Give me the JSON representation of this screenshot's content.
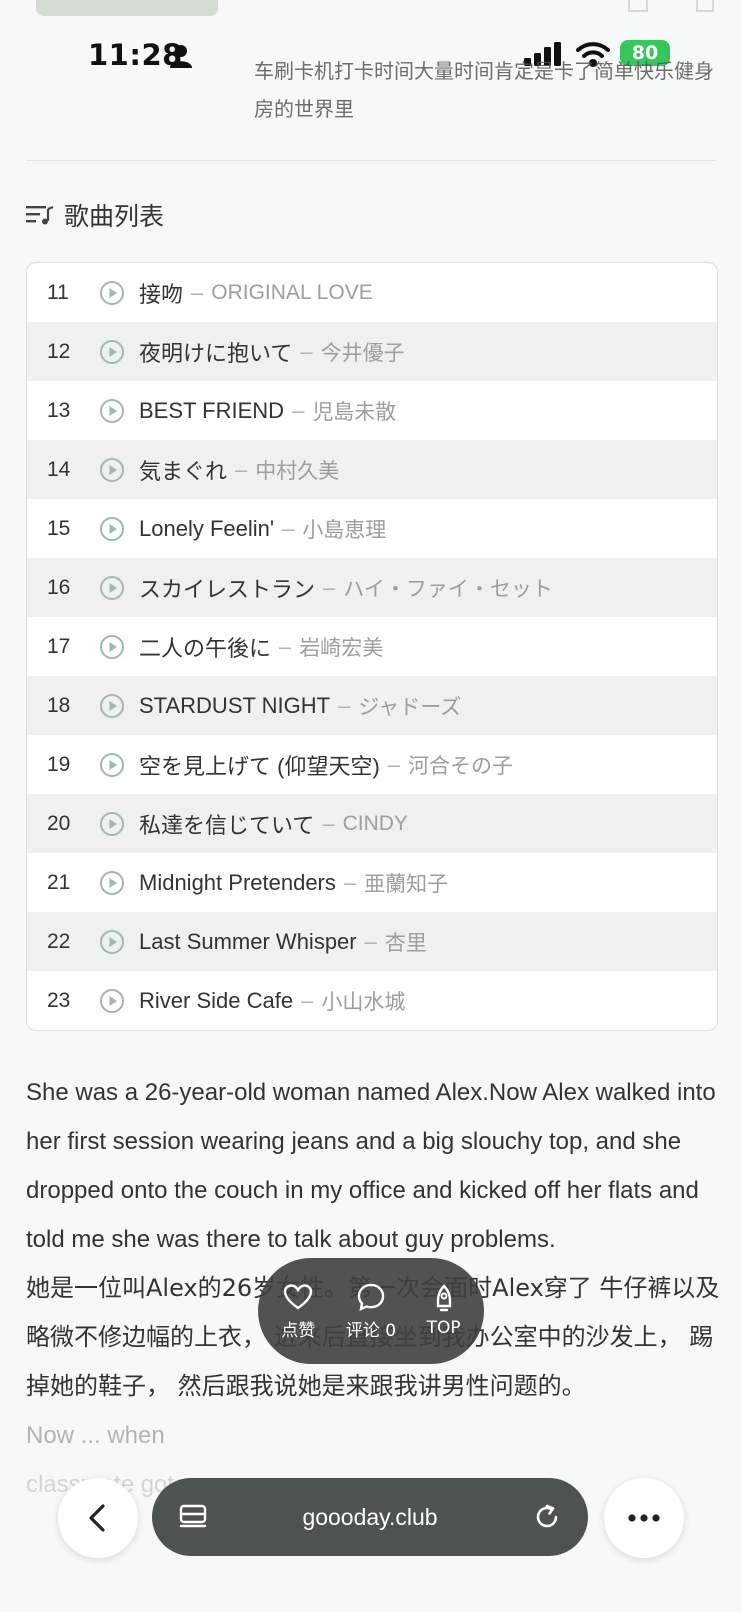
{
  "status": {
    "time": "11:28",
    "battery": "80"
  },
  "intro_text": "车刷卡机打卡时间大量时间肯定是卡了简单快乐健身房的世界里",
  "playlist": {
    "title": "歌曲列表",
    "songs": [
      {
        "num": "11",
        "title": "接吻",
        "artist": "ORIGINAL LOVE"
      },
      {
        "num": "12",
        "title": "夜明けに抱いて",
        "artist": "今井優子"
      },
      {
        "num": "13",
        "title": "BEST FRIEND",
        "artist": "児島未散"
      },
      {
        "num": "14",
        "title": "気まぐれ",
        "artist": "中村久美"
      },
      {
        "num": "15",
        "title": "Lonely Feelin'",
        "artist": "小島恵理"
      },
      {
        "num": "16",
        "title": "スカイレストラン",
        "artist": "ハイ・ファイ・セット"
      },
      {
        "num": "17",
        "title": "二人の午後に",
        "artist": "岩崎宏美"
      },
      {
        "num": "18",
        "title": "STARDUST NIGHT",
        "artist": "ジャドーズ"
      },
      {
        "num": "19",
        "title": "空を見上げて (仰望天空)",
        "artist": "河合その子"
      },
      {
        "num": "20",
        "title": "私達を信じていて",
        "artist": "CINDY"
      },
      {
        "num": "21",
        "title": "Midnight Pretenders",
        "artist": "亜蘭知子"
      },
      {
        "num": "22",
        "title": "Last Summer Whisper",
        "artist": "杏里"
      },
      {
        "num": "23",
        "title": "River Side Cafe",
        "artist": "小山水城"
      }
    ],
    "separator": "–"
  },
  "article": {
    "en": "She was a 26-year-old woman named Alex.Now Alex walked into her first session wearing jeans and a big slouchy top, and she dropped onto the couch in my office and kicked off her flats and told me she was there to talk about guy problems.",
    "zh": "她是一位叫Alex的26岁女性。第一次会面时Alex穿了 牛仔裤以及略微不修边幅的上衣， 进来后直接坐到我办公室中的沙发上， 踢掉她的鞋子， 然后跟我说她是来跟我讲男性问题的。",
    "next_line_1": "Now ... when",
    "next_line_2": "classmate got an"
  },
  "actions": {
    "like": "点赞",
    "comment": "评论 0",
    "top": "TOP"
  },
  "browser": {
    "url": "goooday.club"
  }
}
